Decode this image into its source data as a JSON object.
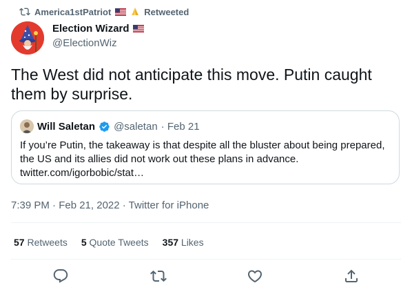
{
  "retweet": {
    "user": "America1stPatriot",
    "label": "Retweeted"
  },
  "tweet": {
    "name": "Election Wizard",
    "handle": "@ElectionWiz",
    "text": "The West did not anticipate this move. Putin caught them by surprise.",
    "time": "7:39 PM · Feb 21, 2022 · Twitter for iPhone"
  },
  "quote": {
    "name": "Will Saletan",
    "handle": "@saletan",
    "date": "· Feb 21",
    "text": "If you’re Putin, the takeaway is that despite all the bluster about being prepared, the US and its allies did not work out these plans in advance. twitter.com/igorbobic/stat…"
  },
  "stats": {
    "retweets_count": "57",
    "retweets_label": "Retweets",
    "quotes_count": "5",
    "quotes_label": "Quote Tweets",
    "likes_count": "357",
    "likes_label": "Likes"
  },
  "colors": {
    "accent": "#1d9bf0",
    "muted": "#536471",
    "border": "#cfd9de"
  },
  "icons": [
    "retweet-icon",
    "us-flag-icon",
    "praying-hands-icon",
    "verified-badge-icon",
    "reply-icon",
    "like-icon",
    "share-icon"
  ]
}
